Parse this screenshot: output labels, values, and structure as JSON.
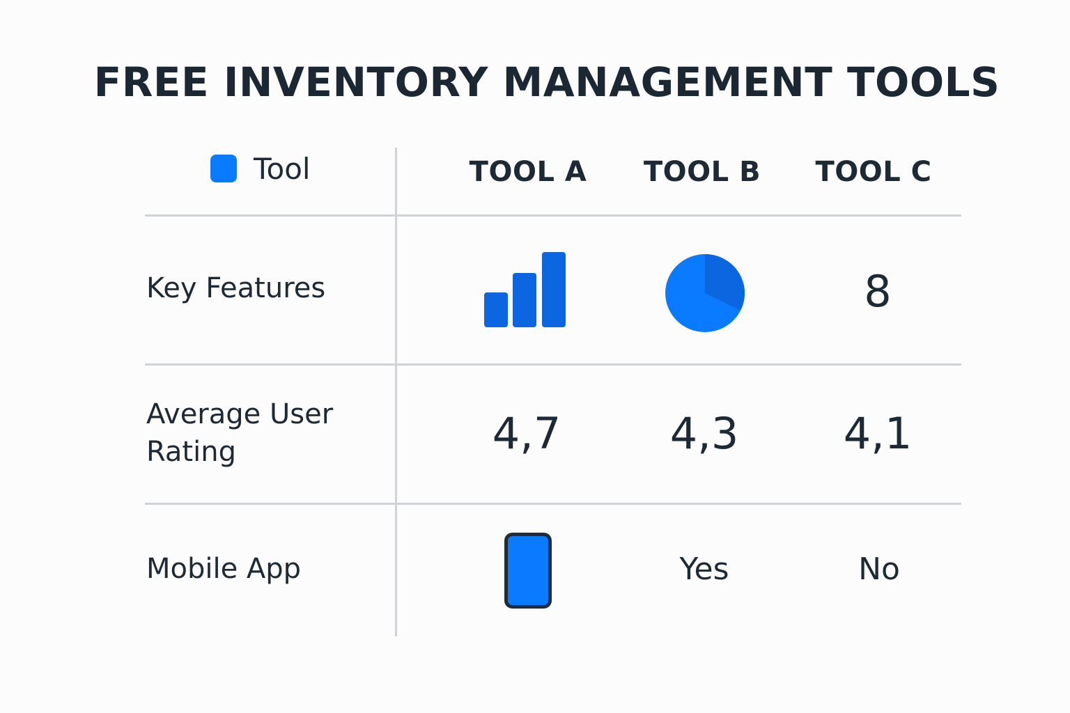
{
  "title": "FREE INVENTORY MANAGEMENT TOOLS",
  "legend": {
    "label": "Tool",
    "color": "#0a7bff"
  },
  "columns": [
    "TOOL A",
    "TOOL B",
    "TOOL C"
  ],
  "rows": [
    {
      "label": "Key Features",
      "cells": [
        {
          "kind": "icon",
          "icon": "bar-chart-icon"
        },
        {
          "kind": "icon",
          "icon": "pie-chart-icon"
        },
        {
          "kind": "text",
          "value": "8"
        }
      ]
    },
    {
      "label": "Average User\nRating",
      "cells": [
        {
          "kind": "text",
          "value": "4,7"
        },
        {
          "kind": "text",
          "value": "4,3"
        },
        {
          "kind": "text",
          "value": "4,1"
        }
      ]
    },
    {
      "label": "Mobile App",
      "cells": [
        {
          "kind": "icon",
          "icon": "mobile-phone-icon"
        },
        {
          "kind": "text",
          "value": "Yes"
        },
        {
          "kind": "text",
          "value": "No"
        }
      ]
    }
  ],
  "colors": {
    "accent": "#0a7bff",
    "accent_dark": "#0b66e0",
    "text": "#1d2935",
    "grid": "#cfd3d8"
  },
  "chart_data": {
    "type": "table",
    "title": "FREE INVENTORY MANAGEMENT TOOLS",
    "columns": [
      "TOOL A",
      "TOOL B",
      "TOOL C"
    ],
    "rows": [
      {
        "label": "Key Features",
        "values": [
          "bar-chart-icon",
          "pie-chart-icon",
          "8"
        ]
      },
      {
        "label": "Average User Rating",
        "values": [
          "4,7",
          "4,3",
          "4,1"
        ]
      },
      {
        "label": "Mobile App",
        "values": [
          "mobile-phone-icon",
          "Yes",
          "No"
        ]
      }
    ]
  }
}
